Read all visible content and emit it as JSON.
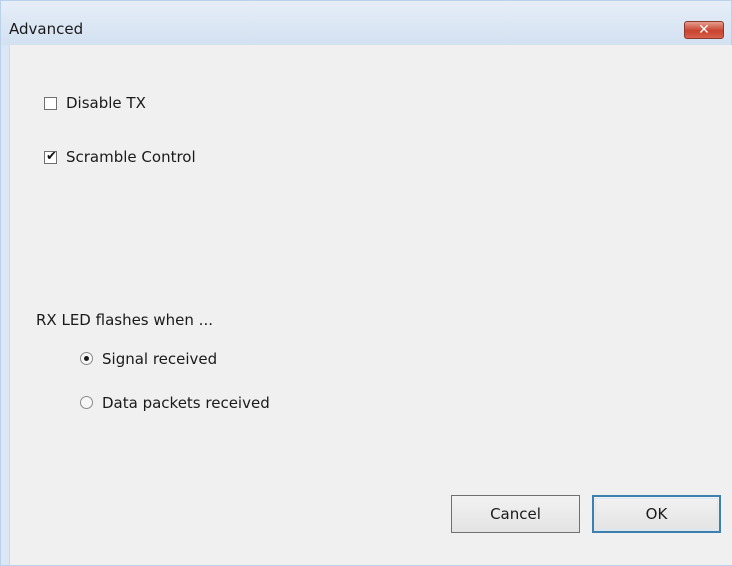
{
  "window": {
    "title": "Advanced",
    "close_glyph": "✕"
  },
  "options": {
    "disable_tx": {
      "label": "Disable TX",
      "checked": false
    },
    "scramble_control": {
      "label": "Scramble Control",
      "checked": true
    }
  },
  "rx_led": {
    "heading": "RX LED flashes when ...",
    "options": [
      {
        "label": "Signal received",
        "selected": true
      },
      {
        "label": "Data packets received",
        "selected": false
      }
    ]
  },
  "buttons": {
    "cancel": "Cancel",
    "ok": "OK"
  },
  "icons": {
    "checkmark": "check-icon",
    "close": "close-icon"
  }
}
